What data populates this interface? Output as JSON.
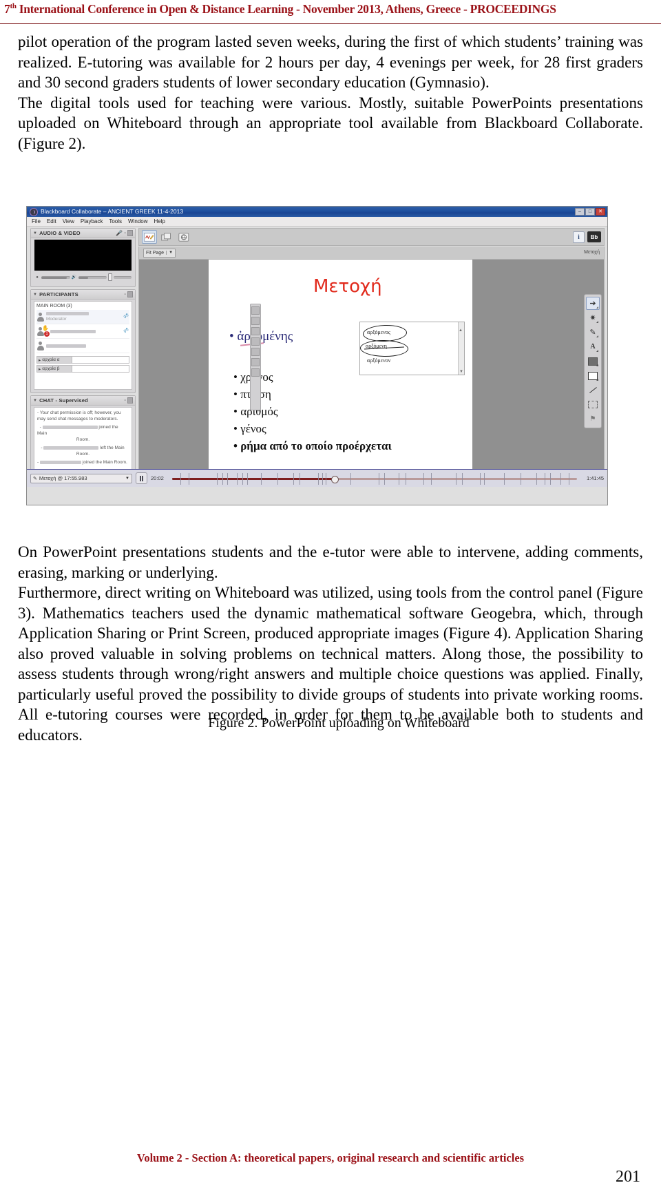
{
  "header": {
    "ordinal": "7",
    "ordinal_sup": "th",
    "text": " International Conference in Open & Distance Learning - November 2013, Athens, Greece - PROCEEDINGS"
  },
  "body": {
    "para1": "pilot operation of the program lasted seven weeks, during the first of which students’ training was realized. E-tutoring was available for 2 hours per day, 4 evenings per week, for 28 first graders and 30 second graders students of lower secondary education (Gymnasio).",
    "para2": "The digital tools used for teaching were various. Mostly, suitable PowerPoints presentations uploaded on Whiteboard through an appropriate tool available from Blackboard Collaborate. (Figure 2).",
    "para3": "On PowerPoint presentations students and the e-tutor were able to intervene, adding comments, erasing, marking or underlying.",
    "para4": "Furthermore, direct writing on Whiteboard was utilized, using tools from the control panel (Figure 3). Mathematics teachers used the dynamic mathematical software Geogebra, which, through Application Sharing or Print Screen, produced appropriate images (Figure 4). Application Sharing also proved valuable in solving problems on technical matters. Along those, the possibility to assess students through wrong/right answers and multiple choice questions was applied. Finally, particularly useful proved the possibility to divide groups of students into private working rooms. All e-tutoring courses were recorded, in order for them to be available both to students and educators."
  },
  "figure": {
    "caption": "Figure 2. PowerPoint uploading on Whiteboard",
    "window": {
      "title": "Blackboard Collaborate – ANCIENT GREEK 11-4-2013",
      "buttons": {
        "minimize": "–",
        "maximize": "□",
        "close": "✕"
      },
      "menu": [
        "File",
        "Edit",
        "View",
        "Playback",
        "Tools",
        "Window",
        "Help"
      ]
    },
    "panels": {
      "audio_video": {
        "title": "AUDIO & VIDEO"
      },
      "participants": {
        "title": "PARTICIPANTS",
        "room_label": "MAIN ROOM  (3)",
        "moderator_role": "Moderator",
        "raised_hand_badge": "1",
        "breakout_rooms": [
          "αρχαία α",
          "αρχαία β"
        ]
      },
      "chat": {
        "title": "CHAT - Supervised",
        "notice": "- Your chat permission is off; however, you may send chat messages to moderators.",
        "msg1_suffix": "joined the Main",
        "msg1_cont": "Room.",
        "msg2_suffix": "left the Main",
        "msg2_cont": "Room.",
        "msg3_suffix": "joined the Main Room."
      }
    },
    "toolbar": {
      "whiteboard_icon": "whiteboard-icon",
      "appshare_icon": "application-sharing-icon",
      "webtour_icon": "web-tour-icon",
      "info_label": "i",
      "logo_label": "Bb",
      "fit_page": "Fit Page",
      "slide_tag": "Μετοχή"
    },
    "slide": {
      "title": "Μετοχή",
      "main_bullet": "ἀρξομένης",
      "bullets": [
        "χρόνος",
        "πτώση",
        "αριθμός",
        "γένος"
      ],
      "last_bullet": "ρήμα από το οποίο προέρχεται",
      "inset_words": [
        "αρξόμενος",
        "αρξόμενη",
        "αρξόμενον"
      ],
      "title_color": "#e12a1c",
      "bullet_color": "#2b2b77"
    },
    "palette": {
      "tools": [
        "pointer",
        "highlighter",
        "pencil",
        "text",
        "filled-rectangle",
        "rectangle",
        "line",
        "screenshot",
        "flag"
      ]
    },
    "playback": {
      "current_label": "Μετοχή @ 17:55.983",
      "elapsed": "20:02",
      "total": "1:41:45",
      "progress_percent": 40
    }
  },
  "footer": {
    "note": "Volume 2 - Section A: theoretical papers, original research and scientific articles",
    "page_number": "201"
  }
}
